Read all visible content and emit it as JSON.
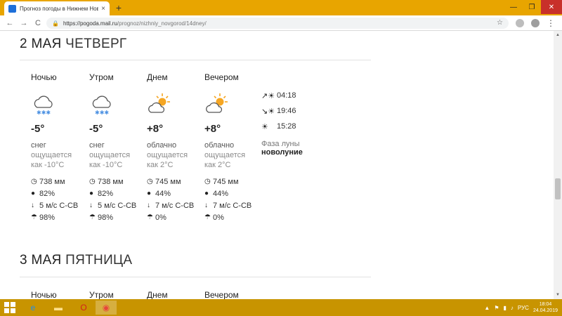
{
  "browser": {
    "tab_title": "Прогноз погоды в Нижнем Нов",
    "tab_close": "×",
    "new_tab": "+",
    "url_host": "https://pogoda.mail.ru",
    "url_path": "/prognoz/nizhniy_novgorod/14dney/",
    "back": "←",
    "forward": "→",
    "reload": "C",
    "star": "☆",
    "menu": "⋮",
    "window": {
      "minimize": "—",
      "maximize": "❐",
      "close": "✕"
    }
  },
  "days": [
    {
      "date": "2 МАЯ",
      "weekday": "ЧЕТВЕРГ",
      "periods": [
        {
          "name": "Ночью",
          "icon": "cloud-snow-icon",
          "temp": "-5°",
          "cond": "снег",
          "feels1": "ощущается",
          "feels2": "как -10°C",
          "pressure": "738 мм",
          "humidity": "82%",
          "wind": "5 м/с С-СВ",
          "precip": "98%"
        },
        {
          "name": "Утром",
          "icon": "cloud-snow-icon",
          "temp": "-5°",
          "cond": "снег",
          "feels1": "ощущается",
          "feels2": "как -10°C",
          "pressure": "738 мм",
          "humidity": "82%",
          "wind": "5 м/с С-СВ",
          "precip": "98%"
        },
        {
          "name": "Днем",
          "icon": "partly-cloudy-icon",
          "temp": "+8°",
          "cond": "облачно",
          "feels1": "ощущается",
          "feels2": "как 2°C",
          "pressure": "745 мм",
          "humidity": "44%",
          "wind": "7 м/с С-СВ",
          "precip": "0%"
        },
        {
          "name": "Вечером",
          "icon": "partly-cloudy-icon",
          "temp": "+8°",
          "cond": "облачно",
          "feels1": "ощущается",
          "feels2": "как 2°C",
          "pressure": "745 мм",
          "humidity": "44%",
          "wind": "7 м/с С-СВ",
          "precip": "0%"
        }
      ],
      "sun": {
        "sunrise": "04:18",
        "sunset": "19:46",
        "daylength": "15:28"
      },
      "moon": {
        "label": "Фаза луны",
        "value": "новолуние"
      }
    },
    {
      "date": "3 МАЯ",
      "weekday": "ПЯТНИЦА",
      "periods": [
        {
          "name": "Ночью"
        },
        {
          "name": "Утром"
        },
        {
          "name": "Днем"
        },
        {
          "name": "Вечером"
        }
      ]
    }
  ],
  "taskbar": {
    "lang": "РУС",
    "time": "18:04",
    "date": "24.04.2019"
  },
  "colors": {
    "titlebar": "#e8a500",
    "taskbar": "#c89400",
    "sun": "#f5a623",
    "cloud": "#555555",
    "snow": "#4a90e2"
  }
}
